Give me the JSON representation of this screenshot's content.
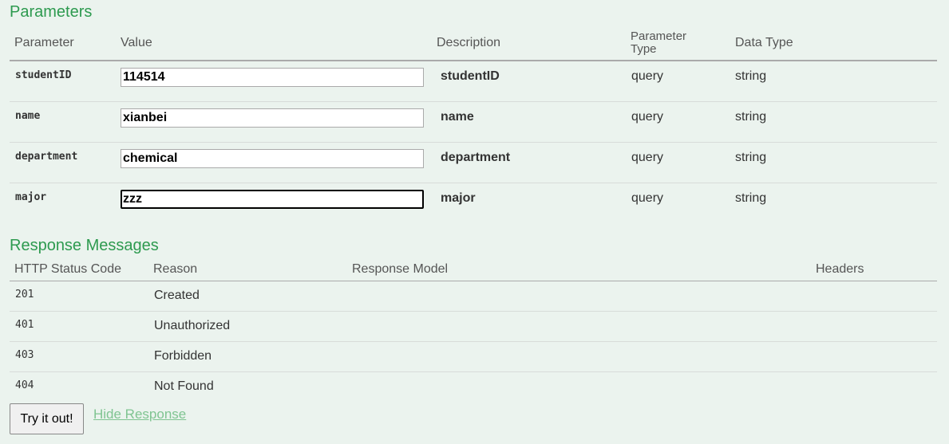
{
  "parameters": {
    "title": "Parameters",
    "headers": {
      "parameter": "Parameter",
      "value": "Value",
      "description": "Description",
      "param_type_line1": "Parameter",
      "param_type_line2": "Type",
      "data_type": "Data Type"
    },
    "rows": [
      {
        "name": "studentID",
        "value": "114514",
        "description": "studentID",
        "param_type": "query",
        "data_type": "string"
      },
      {
        "name": "name",
        "value": "xianbei",
        "description": "name",
        "param_type": "query",
        "data_type": "string"
      },
      {
        "name": "department",
        "value": "chemical",
        "description": "department",
        "param_type": "query",
        "data_type": "string"
      },
      {
        "name": "major",
        "value": "zzz",
        "description": "major",
        "param_type": "query",
        "data_type": "string"
      }
    ]
  },
  "responses": {
    "title": "Response Messages",
    "headers": {
      "status_code": "HTTP Status Code",
      "reason": "Reason",
      "model": "Response Model",
      "headers": "Headers"
    },
    "rows": [
      {
        "code": "201",
        "reason": "Created"
      },
      {
        "code": "401",
        "reason": "Unauthorized"
      },
      {
        "code": "403",
        "reason": "Forbidden"
      },
      {
        "code": "404",
        "reason": "Not Found"
      }
    ]
  },
  "actions": {
    "try_label": "Try it out!",
    "hide_label": "Hide Response"
  }
}
